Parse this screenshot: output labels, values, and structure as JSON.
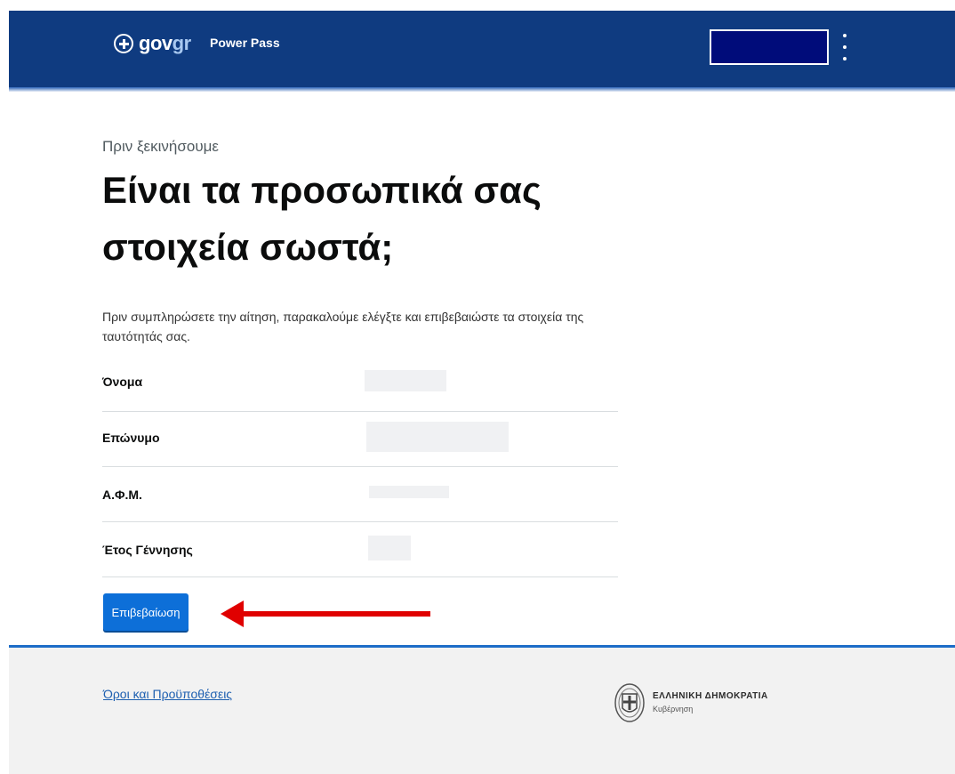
{
  "header": {
    "logo_gov": "gov",
    "logo_gr": "gr",
    "service_name": "Power Pass",
    "logo_icon": "greek-cross-emblem-icon",
    "menu_icon": "vertical-dots-icon"
  },
  "main": {
    "pre_title": "Πριν ξεκινήσουμε",
    "title": "Είναι τα προσωπικά σας στοιχεία σωστά;",
    "intro": "Πριν συμπληρώσετε την αίτηση, παρακαλούμε ελέγξτε και επιβεβαιώστε τα στοιχεία της ταυτότητάς σας.",
    "fields": [
      {
        "label": "Όνομα"
      },
      {
        "label": "Επώνυμο"
      },
      {
        "label": "Α.Φ.Μ."
      },
      {
        "label": "Έτος Γέννησης"
      }
    ],
    "confirm_label": "Επιβεβαίωση",
    "annotation_arrow": "red-arrow-icon"
  },
  "footer": {
    "terms_link": "Όροι και Προϋποθέσεις",
    "gov_name": "ΕΛΛΗΝΙΚΗ ΔΗΜΟΚΡΑΤΙΑ",
    "gov_sub": "Κυβέρνηση",
    "gov_emblem": "greek-coat-of-arms-icon"
  },
  "colors": {
    "header_bg": "#0f3b80",
    "button_bg": "#0d6fd8",
    "arrow": "#e00000",
    "footer_bg": "#f2f2f2",
    "link": "#1d5fb0"
  }
}
